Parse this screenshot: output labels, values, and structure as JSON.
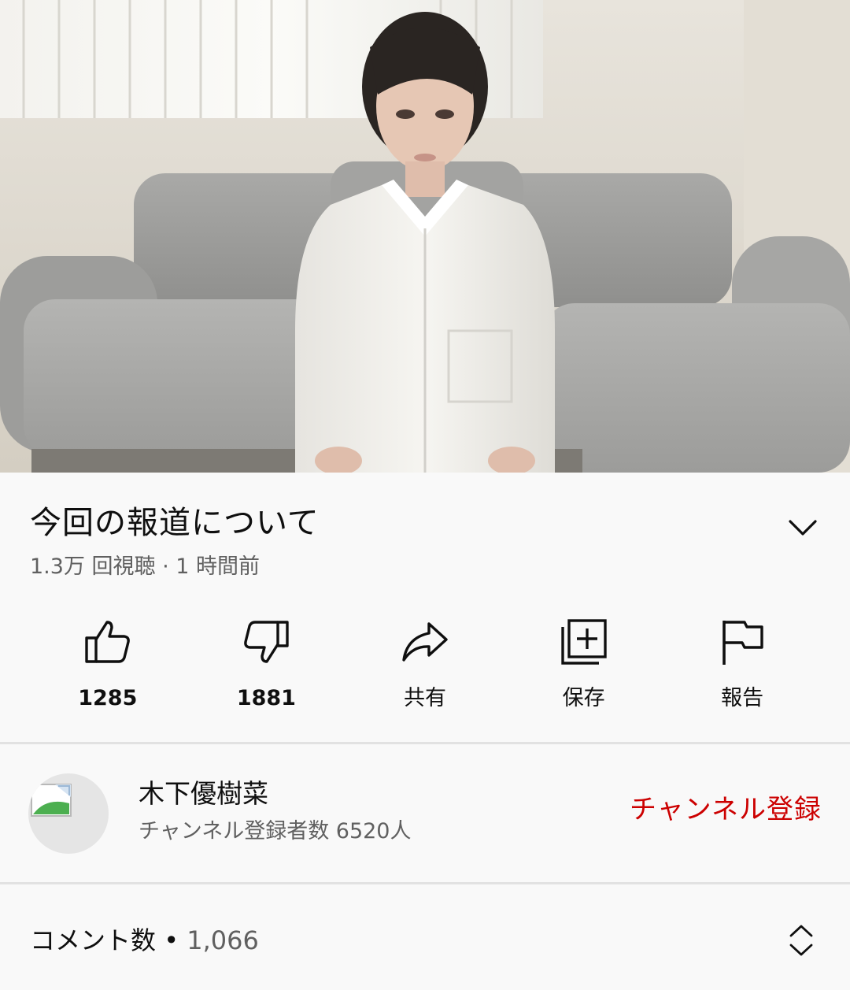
{
  "video": {
    "title": "今回の報道について",
    "views": "1.3万 回視聴",
    "separator": " · ",
    "age": "1 時間前"
  },
  "actions": [
    {
      "icon": "thumbs-up-icon",
      "label": "1285"
    },
    {
      "icon": "thumbs-down-icon",
      "label": "1881"
    },
    {
      "icon": "share-icon",
      "label": "共有"
    },
    {
      "icon": "add-to-playlist-icon",
      "label": "保存"
    },
    {
      "icon": "flag-icon",
      "label": "報告"
    }
  ],
  "channel": {
    "name": "木下優樹菜",
    "subscribers": "チャンネル登録者数 6520人",
    "subscribe_label": "チャンネル登録"
  },
  "comments": {
    "label": "コメント数",
    "separator": " • ",
    "count": "1,066"
  },
  "colors": {
    "subscribe": "#cc0000",
    "secondary_text": "#606060",
    "background": "#f9f9f9"
  }
}
